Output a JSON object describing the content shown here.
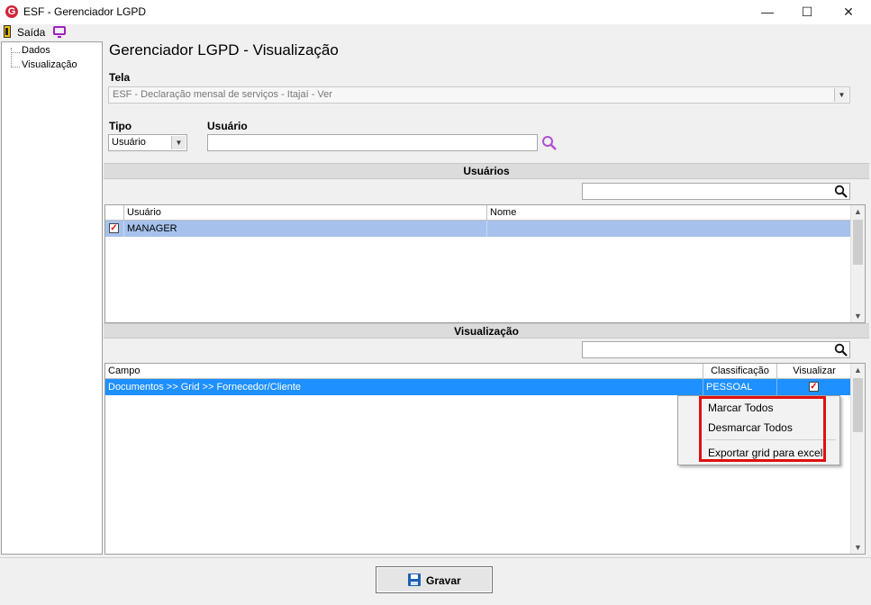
{
  "window": {
    "title": "ESF - Gerenciador LGPD",
    "app_icon_letter": "G",
    "controls": {
      "minimize": "—",
      "maximize": "☐",
      "close": "✕"
    }
  },
  "toolbar": {
    "exit_label": "Saída"
  },
  "tree": {
    "items": [
      "Dados",
      "Visualização"
    ]
  },
  "page": {
    "title": "Gerenciador LGPD - Visualização"
  },
  "form": {
    "tela_label": "Tela",
    "tela_value": "ESF - Declaração mensal de serviços - Itajaí - Ver",
    "tipo_label": "Tipo",
    "tipo_value": "Usuário",
    "usuario_label": "Usuário",
    "usuario_value": ""
  },
  "users_section": {
    "header": "Usuários",
    "search_value": "",
    "columns": [
      "Usuário",
      "Nome"
    ],
    "rows": [
      {
        "checked": true,
        "usuario": "MANAGER",
        "nome": ""
      }
    ]
  },
  "view_section": {
    "header": "Visualização",
    "search_value": "",
    "columns": [
      "Campo",
      "Classificação",
      "Visualizar"
    ],
    "rows": [
      {
        "campo": "Documentos >> Grid >> Fornecedor/Cliente",
        "classificacao": "PESSOAL",
        "visualizar": true
      }
    ]
  },
  "context_menu": {
    "items": [
      "Marcar Todos",
      "Desmarcar Todos",
      "Exportar grid para excel"
    ]
  },
  "footer": {
    "save_label": "Gravar"
  },
  "colors": {
    "selected_row_users": "#a6c2ec",
    "selected_row_view": "#1e90ff",
    "highlight_box": "#e01010",
    "brand_icon": "#d0263b"
  }
}
